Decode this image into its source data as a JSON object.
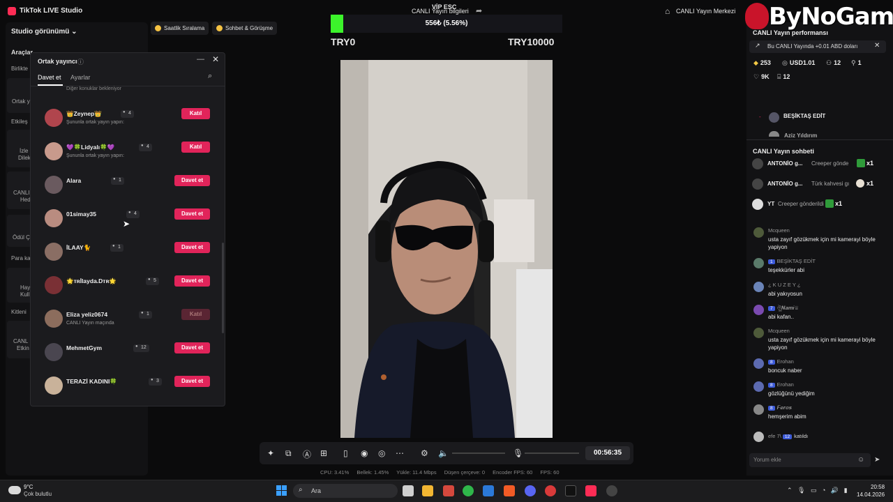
{
  "app": {
    "title": "TikTok LIVE Studio",
    "center_title": "CANLI Yayın bilgileri",
    "right_title": "CANLI Yayın Merkezi"
  },
  "left": {
    "studio_view": "Studio görünümü",
    "chips": [
      {
        "label": "Saatlik Sıralama"
      },
      {
        "label": "Sohbet & Görüşme"
      }
    ],
    "section_tools": "Araçlar",
    "side_labels": [
      "Birlikte",
      "Ortak y",
      "Etkileş",
      "İzle",
      "Dilek",
      "CANLI",
      "Hed",
      "Ödül Ç",
      "Para ka",
      "Hay",
      "Kull",
      "Kitleni",
      "CANL",
      "Etkin"
    ]
  },
  "popup": {
    "title": "Ortak yayıncı",
    "tabs": [
      "Davet et",
      "Ayarlar"
    ],
    "top_partial_text": "Diğer konuklar bekleniyor",
    "rows": [
      {
        "name": "👑Zeynep👑",
        "count": "4",
        "sub": "Şununla ortak yayın yapın:",
        "button": "Katıl",
        "disabled": false,
        "avatar_color": "#b0454d"
      },
      {
        "name": "💜🍀Lidyalı🍀💜",
        "count": "4",
        "sub": "Şununla ortak yayın yapın:",
        "button": "Katıl",
        "disabled": false,
        "avatar_color": "#c89a8c"
      },
      {
        "name": "Alara",
        "count": "1",
        "sub": "",
        "button": "Davet et",
        "disabled": false,
        "avatar_color": "#6a5a5f"
      },
      {
        "name": "01simay35",
        "count": "4",
        "sub": "",
        "button": "Davet et",
        "disabled": false,
        "avatar_color": "#b98c80"
      },
      {
        "name": "İLAAY🐈",
        "count": "1",
        "sub": "",
        "button": "Davet et",
        "disabled": false,
        "avatar_color": "#8a6e64"
      },
      {
        "name": "🌟ᴛʀİlayda.Dᴛʀ🌟",
        "count": "5",
        "sub": "",
        "button": "Davet et",
        "disabled": false,
        "avatar_color": "#7a3035"
      },
      {
        "name": "Eliza yeliz0674",
        "count": "1",
        "sub": "CANLI Yayın maçında",
        "button": "Katıl",
        "disabled": true,
        "avatar_color": "#8c6d5d"
      },
      {
        "name": "MehmetGym",
        "count": "12",
        "sub": "",
        "button": "Davet et",
        "disabled": false,
        "avatar_color": "#4a4650"
      },
      {
        "name": "TERAZİ KADINI🍀",
        "count": "3",
        "sub": "",
        "button": "Davet et",
        "disabled": false,
        "avatar_color": "#c9b29a"
      }
    ]
  },
  "goal": {
    "label": "VİP ESC",
    "text": "556₺ (5.56%)",
    "progress": 0.0556,
    "min": "TRY0",
    "max": "TRY10000",
    "fill_color": "#3cf32b"
  },
  "controls": {
    "timer": "00:56:35"
  },
  "stats": [
    "CPU: 3.41%",
    "Bellek: 1.45%",
    "Yükle: 11.4 Mbps",
    "Düşen çerçeve: 0",
    "Encoder FPS: 60",
    "FPS: 60"
  ],
  "right": {
    "watermark": "ByNoGame",
    "perf_title": "CANLI Yayın performansı",
    "perf_banner": "Bu CANLI Yayında +0.01 ABD doları",
    "stats": [
      "253",
      "USD1.01",
      "12",
      "1",
      "9K",
      "12"
    ],
    "ranking": [
      "BEŞİKTAŞ EDİT",
      "Aziz Yıldırım"
    ],
    "chat_title": "CANLI Yayın sohbeti",
    "gifts": [
      {
        "name": "ANTONİO g...",
        "text": "Creeper gönde",
        "mult": "x1"
      },
      {
        "name": "ANTONİO g...",
        "text": "Türk kahvesi gı",
        "mult": "x1"
      },
      {
        "name": "YT",
        "text": "Creeper gönderildi",
        "mult": "x1"
      }
    ],
    "messages": [
      {
        "user": "Mcqueen",
        "level": "",
        "text": "usta zayıf gözükmek için mi kamerayi böyle yapiyon"
      },
      {
        "user": "BEŞİKTAŞ EDİT",
        "level": "1",
        "text": "teşekkürler abi"
      },
      {
        "user": "¿ K U Z E Y ¿",
        "level": "",
        "text": "abi yakıyosun"
      },
      {
        "user": "ঔৣ𝑵𝒂𝒎𝒊♕",
        "level": "7",
        "text": "abi kafan.."
      },
      {
        "user": "Mcqueen",
        "level": "",
        "text": "usta zayıf gözükmek için mi kamerayi böyle yapiyon"
      },
      {
        "user": "Erohan",
        "level": "8",
        "text": "boncuk naber"
      },
      {
        "user": "Erohan",
        "level": "8",
        "text": "gözlüğünü yediğim"
      },
      {
        "user": "𝑭𝒆𝒓𝒐𝒔",
        "level": "8",
        "text": "hemşerim abim"
      }
    ],
    "join": {
      "user": "efe 7\\",
      "level": "12",
      "text": "katıldı"
    },
    "comment_placeholder": "Yorum ekle"
  },
  "taskbar": {
    "temp": "9°C",
    "weather": "Çok bulutlu",
    "search": "Ara",
    "time": "20:58",
    "date": "14.04.2026"
  }
}
